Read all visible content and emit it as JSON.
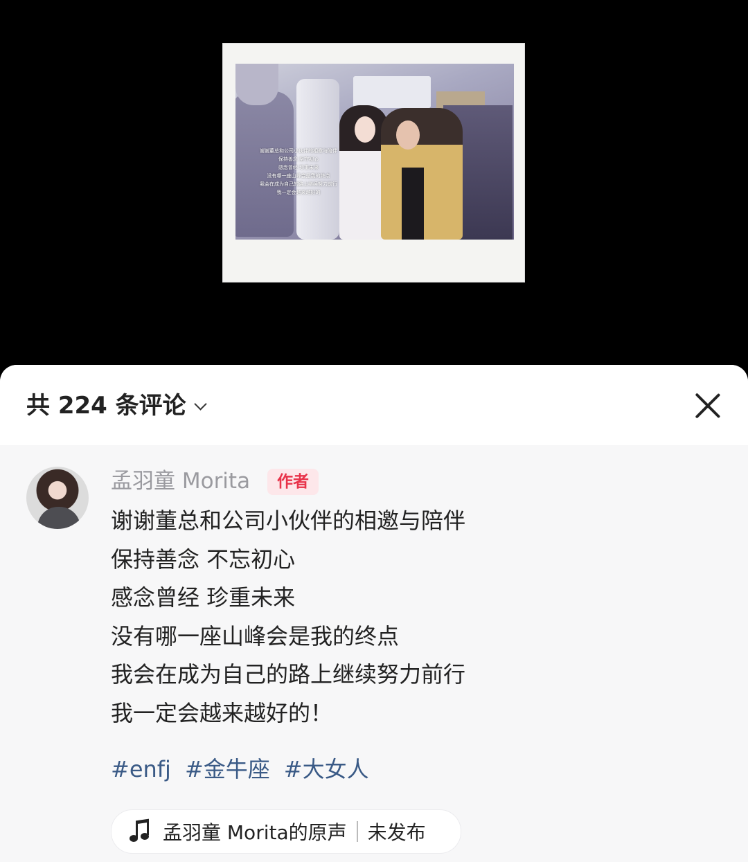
{
  "media": {
    "caption_lines": [
      "谢谢董总和公司小伙伴的相邀与陪伴",
      "保持善念 坚守初心",
      "感念曾经 珍重未来",
      "没有哪一座山峰会是我的终点",
      "我会在成为自己的路上继续努力前行",
      "我一定会越来越好的"
    ]
  },
  "header": {
    "comment_count_label": "共 224 条评论"
  },
  "comment": {
    "author_name": "孟羽童 Morita",
    "author_tag": "作者",
    "lines": [
      "谢谢董总和公司小伙伴的相邀与陪伴",
      "保持善念 不忘初心",
      "感念曾经 珍重未来",
      "没有哪一座山峰会是我的终点",
      "我会在成为自己的路上继续努力前行",
      "我一定会越来越好的！"
    ],
    "tags": [
      "#enfj",
      "#金牛座",
      "#大女人"
    ],
    "sound": {
      "label": "孟羽童 Morita的原声",
      "status": "未发布"
    }
  },
  "colors": {
    "tag_text": "#3a5a86",
    "author_badge_bg": "#fde7ea",
    "author_badge_text": "#e8334a"
  }
}
